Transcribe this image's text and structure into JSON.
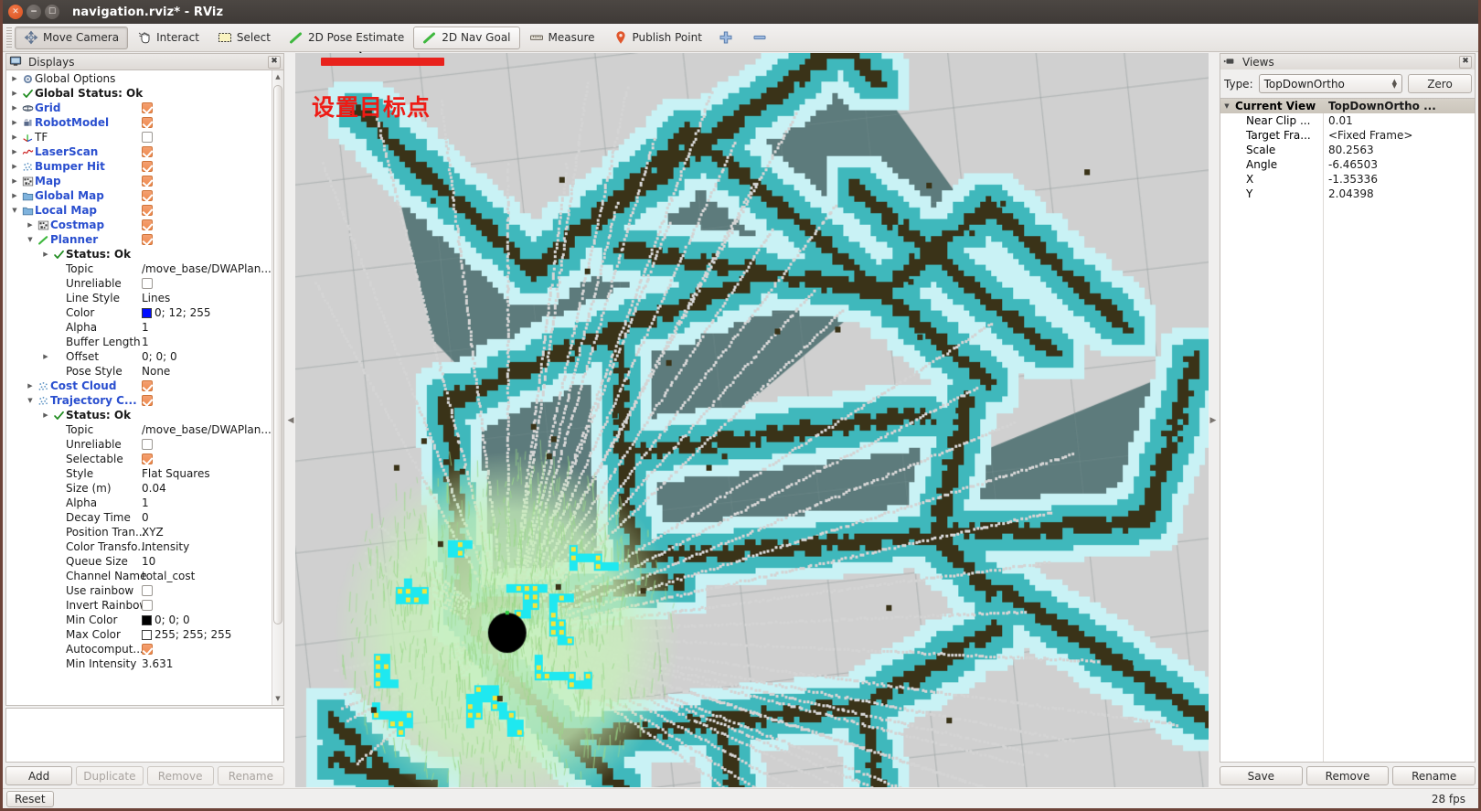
{
  "window": {
    "title": "navigation.rviz* - RViz",
    "controls": [
      "close",
      "minimize",
      "maximize"
    ]
  },
  "toolbar": {
    "items": [
      {
        "label": "Move Camera",
        "icon": "move-camera-icon",
        "state": "pressed"
      },
      {
        "label": "Interact",
        "icon": "hand-interact-icon",
        "state": "normal"
      },
      {
        "label": "Select",
        "icon": "select-rect-icon",
        "state": "normal"
      },
      {
        "label": "2D Pose Estimate",
        "icon": "green-arrow-icon",
        "state": "normal"
      },
      {
        "label": "2D Nav Goal",
        "icon": "green-arrow-icon",
        "state": "active"
      },
      {
        "label": "Measure",
        "icon": "ruler-icon",
        "state": "normal"
      },
      {
        "label": "Publish Point",
        "icon": "map-pin-icon",
        "state": "normal"
      },
      {
        "label": "",
        "icon": "plus-icon",
        "state": "normal"
      },
      {
        "label": "",
        "icon": "minus-icon",
        "state": "normal"
      }
    ]
  },
  "displays": {
    "panel_title": "Displays",
    "close_label": "✖",
    "rows": [
      {
        "indent": 0,
        "arrow": "▶",
        "icon": "gear-icon",
        "label": "Global Options",
        "style": "plain",
        "value_type": "none"
      },
      {
        "indent": 0,
        "arrow": "▶",
        "icon": "check-icon",
        "label": "Global Status: Ok",
        "style": "bold",
        "value_type": "none"
      },
      {
        "indent": 0,
        "arrow": "▶",
        "icon": "grid-icon",
        "label": "Grid",
        "style": "blue",
        "value_type": "checkbox",
        "checked": true
      },
      {
        "indent": 0,
        "arrow": "▶",
        "icon": "robot-icon",
        "label": "RobotModel",
        "style": "blue",
        "value_type": "checkbox",
        "checked": true
      },
      {
        "indent": 0,
        "arrow": "▶",
        "icon": "tf-axes-icon",
        "label": "TF",
        "style": "plain",
        "value_type": "checkbox",
        "checked": false
      },
      {
        "indent": 0,
        "arrow": "▶",
        "icon": "laserscan-icon",
        "label": "LaserScan",
        "style": "blue",
        "value_type": "checkbox",
        "checked": true
      },
      {
        "indent": 0,
        "arrow": "▶",
        "icon": "pointcloud-icon",
        "label": "Bumper Hit",
        "style": "blue",
        "value_type": "checkbox",
        "checked": true
      },
      {
        "indent": 0,
        "arrow": "▶",
        "icon": "map-icon",
        "label": "Map",
        "style": "blue",
        "value_type": "checkbox",
        "checked": true
      },
      {
        "indent": 0,
        "arrow": "▶",
        "icon": "folder-icon",
        "label": "Global Map",
        "style": "blue",
        "value_type": "checkbox",
        "checked": true
      },
      {
        "indent": 0,
        "arrow": "▼",
        "icon": "folder-icon",
        "label": "Local Map",
        "style": "blue",
        "value_type": "checkbox",
        "checked": true
      },
      {
        "indent": 1,
        "arrow": "▶",
        "icon": "map-icon",
        "label": "Costmap",
        "style": "blue",
        "value_type": "checkbox",
        "checked": true
      },
      {
        "indent": 1,
        "arrow": "▼",
        "icon": "path-icon",
        "label": "Planner",
        "style": "blue",
        "value_type": "checkbox",
        "checked": true
      },
      {
        "indent": 2,
        "arrow": "▶",
        "icon": "check-icon",
        "label": "Status: Ok",
        "style": "bold",
        "value_type": "none"
      },
      {
        "indent": 2,
        "arrow": "",
        "icon": "",
        "label": "Topic",
        "style": "plain",
        "value_type": "text",
        "value": "/move_base/DWAPlan..."
      },
      {
        "indent": 2,
        "arrow": "",
        "icon": "",
        "label": "Unreliable",
        "style": "plain",
        "value_type": "checkbox",
        "checked": false
      },
      {
        "indent": 2,
        "arrow": "",
        "icon": "",
        "label": "Line Style",
        "style": "plain",
        "value_type": "text",
        "value": "Lines"
      },
      {
        "indent": 2,
        "arrow": "",
        "icon": "",
        "label": "Color",
        "style": "plain",
        "value_type": "color",
        "value": "0; 12; 255",
        "color": "#000cff"
      },
      {
        "indent": 2,
        "arrow": "",
        "icon": "",
        "label": "Alpha",
        "style": "plain",
        "value_type": "text",
        "value": "1"
      },
      {
        "indent": 2,
        "arrow": "",
        "icon": "",
        "label": "Buffer Length",
        "style": "plain",
        "value_type": "text",
        "value": "1"
      },
      {
        "indent": 2,
        "arrow": "▶",
        "icon": "",
        "label": "Offset",
        "style": "plain",
        "value_type": "text",
        "value": "0; 0; 0"
      },
      {
        "indent": 2,
        "arrow": "",
        "icon": "",
        "label": "Pose Style",
        "style": "plain",
        "value_type": "text",
        "value": "None"
      },
      {
        "indent": 1,
        "arrow": "▶",
        "icon": "pointcloud-icon",
        "label": "Cost Cloud",
        "style": "blue",
        "value_type": "checkbox",
        "checked": true
      },
      {
        "indent": 1,
        "arrow": "▼",
        "icon": "pointcloud-icon",
        "label": "Trajectory C...",
        "style": "blue",
        "value_type": "checkbox",
        "checked": true
      },
      {
        "indent": 2,
        "arrow": "▶",
        "icon": "check-icon",
        "label": "Status: Ok",
        "style": "bold",
        "value_type": "none"
      },
      {
        "indent": 2,
        "arrow": "",
        "icon": "",
        "label": "Topic",
        "style": "plain",
        "value_type": "text",
        "value": "/move_base/DWAPlan..."
      },
      {
        "indent": 2,
        "arrow": "",
        "icon": "",
        "label": "Unreliable",
        "style": "plain",
        "value_type": "checkbox",
        "checked": false
      },
      {
        "indent": 2,
        "arrow": "",
        "icon": "",
        "label": "Selectable",
        "style": "plain",
        "value_type": "checkbox",
        "checked": true
      },
      {
        "indent": 2,
        "arrow": "",
        "icon": "",
        "label": "Style",
        "style": "plain",
        "value_type": "text",
        "value": "Flat Squares"
      },
      {
        "indent": 2,
        "arrow": "",
        "icon": "",
        "label": "Size (m)",
        "style": "plain",
        "value_type": "text",
        "value": "0.04"
      },
      {
        "indent": 2,
        "arrow": "",
        "icon": "",
        "label": "Alpha",
        "style": "plain",
        "value_type": "text",
        "value": "1"
      },
      {
        "indent": 2,
        "arrow": "",
        "icon": "",
        "label": "Decay Time",
        "style": "plain",
        "value_type": "text",
        "value": "0"
      },
      {
        "indent": 2,
        "arrow": "",
        "icon": "",
        "label": "Position Tran...",
        "style": "plain",
        "value_type": "text",
        "value": "XYZ"
      },
      {
        "indent": 2,
        "arrow": "",
        "icon": "",
        "label": "Color Transfo...",
        "style": "plain",
        "value_type": "text",
        "value": "Intensity"
      },
      {
        "indent": 2,
        "arrow": "",
        "icon": "",
        "label": "Queue Size",
        "style": "plain",
        "value_type": "text",
        "value": "10"
      },
      {
        "indent": 2,
        "arrow": "",
        "icon": "",
        "label": "Channel Name",
        "style": "plain",
        "value_type": "text",
        "value": "total_cost"
      },
      {
        "indent": 2,
        "arrow": "",
        "icon": "",
        "label": "Use rainbow",
        "style": "plain",
        "value_type": "checkbox",
        "checked": false
      },
      {
        "indent": 2,
        "arrow": "",
        "icon": "",
        "label": "Invert Rainbow",
        "style": "plain",
        "value_type": "checkbox",
        "checked": false
      },
      {
        "indent": 2,
        "arrow": "",
        "icon": "",
        "label": "Min Color",
        "style": "plain",
        "value_type": "color",
        "value": "0; 0; 0",
        "color": "#000000"
      },
      {
        "indent": 2,
        "arrow": "",
        "icon": "",
        "label": "Max Color",
        "style": "plain",
        "value_type": "color",
        "value": "255; 255; 255",
        "color": "#ffffff"
      },
      {
        "indent": 2,
        "arrow": "",
        "icon": "",
        "label": "Autocomput...",
        "style": "plain",
        "value_type": "checkbox",
        "checked": true
      },
      {
        "indent": 2,
        "arrow": "",
        "icon": "",
        "label": "Min Intensity",
        "style": "plain",
        "value_type": "text",
        "value": "3.631"
      }
    ],
    "buttons": [
      {
        "label": "Add",
        "enabled": true
      },
      {
        "label": "Duplicate",
        "enabled": false
      },
      {
        "label": "Remove",
        "enabled": false
      },
      {
        "label": "Rename",
        "enabled": false
      }
    ]
  },
  "views": {
    "panel_title": "Views",
    "close_label": "✖",
    "type_label": "Type:",
    "type_value": "TopDownOrtho",
    "zero_label": "Zero",
    "header": {
      "name": "Current View",
      "value": "TopDownOrtho ..."
    },
    "rows": [
      {
        "label": "Near Clip ...",
        "value": "0.01"
      },
      {
        "label": "Target Fra...",
        "value": "<Fixed Frame>"
      },
      {
        "label": "Scale",
        "value": "80.2563"
      },
      {
        "label": "Angle",
        "value": "-6.46503"
      },
      {
        "label": "X",
        "value": "-1.35336"
      },
      {
        "label": "Y",
        "value": "2.04398"
      }
    ],
    "buttons": [
      {
        "label": "Save",
        "enabled": true
      },
      {
        "label": "Remove",
        "enabled": true
      },
      {
        "label": "Rename",
        "enabled": true
      }
    ]
  },
  "view3d": {
    "annotation_text": "设置目标点",
    "annotation_color": "#ee1b15",
    "colors": {
      "background": "#c9c9c9",
      "free_space": "#d0d0d0",
      "unknown": "#5d7b7c",
      "lethal_obstacle": "#3a3318",
      "inflation_near": "#3fb8bc",
      "inflation_far": "#c9f2f5",
      "laser_scan": "#d4d4d4",
      "cost_cloud_low": "#c8f0bb",
      "cost_cloud_mid": "#f2e43c",
      "cost_cloud_high": "#1fe8f0",
      "robot_body": "#000000",
      "grid_line": "#a8a8a8"
    }
  },
  "statusbar": {
    "reset_label": "Reset",
    "fps": "28 fps"
  }
}
